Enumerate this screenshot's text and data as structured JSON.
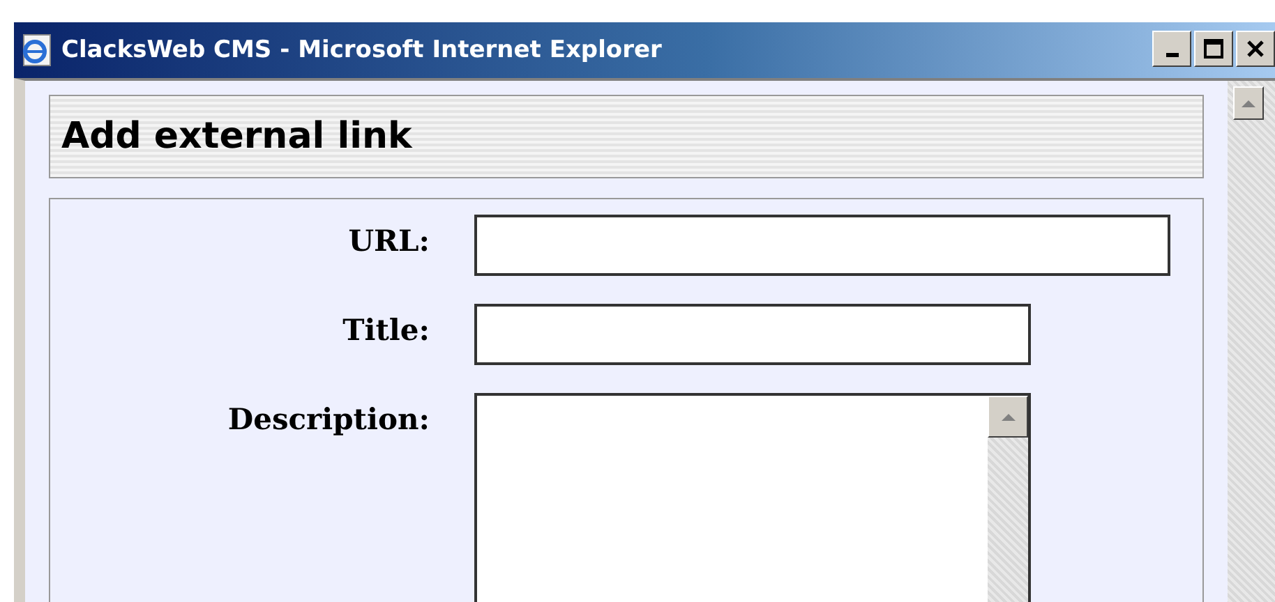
{
  "window": {
    "title": "ClacksWeb CMS - Microsoft Internet Explorer"
  },
  "heading": "Add external link",
  "fields": [
    {
      "label": "URL:",
      "kind": "long"
    },
    {
      "label": "Title:",
      "kind": "short"
    },
    {
      "label": "Description:",
      "kind": "multiline"
    }
  ]
}
